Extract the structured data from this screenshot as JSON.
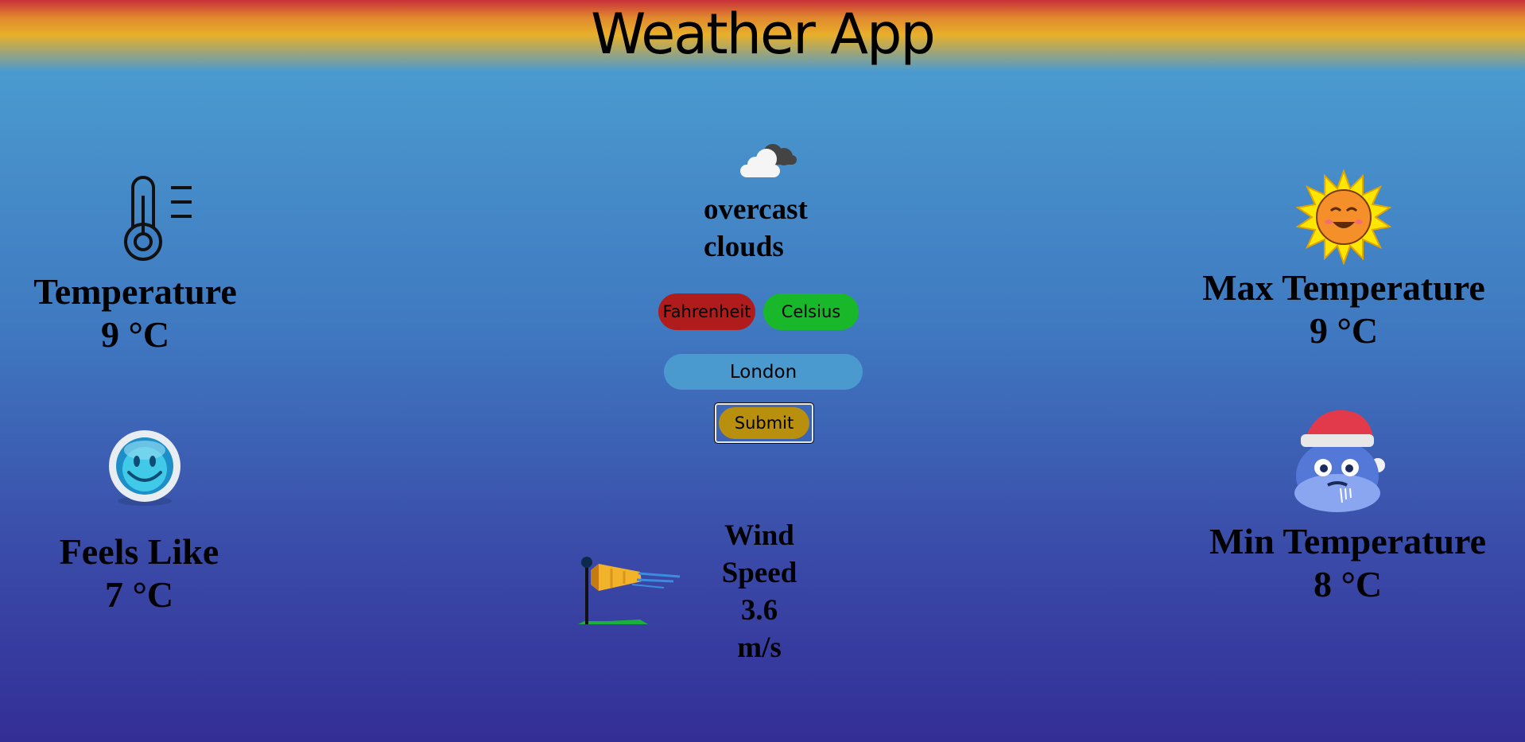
{
  "app": {
    "title": "Weather App"
  },
  "temperature": {
    "label": "Temperature",
    "value": "9 °C",
    "icon": "thermometer-icon"
  },
  "feels_like": {
    "label": "Feels Like",
    "value": "7 °C",
    "icon": "smiley-icon"
  },
  "max_temperature": {
    "label": "Max Temperature",
    "value": "9 °C",
    "icon": "sun-icon"
  },
  "min_temperature": {
    "label": "Min Temperature",
    "value": "8 °C",
    "icon": "cold-cloud-icon"
  },
  "conditions": {
    "description_line1": "overcast",
    "description_line2": "clouds",
    "icon": "overcast-clouds-icon"
  },
  "units": {
    "fahrenheit_label": "Fahrenheit",
    "celsius_label": "Celsius",
    "fahrenheit_color": "#b01c1c",
    "celsius_color": "#18b82a"
  },
  "search": {
    "value": "London",
    "submit_label": "Submit",
    "submit_color": "#b8900e"
  },
  "wind": {
    "line1": "Wind",
    "line2": "Speed",
    "value": "3.6",
    "unit": "m/s",
    "icon": "windsock-icon"
  }
}
